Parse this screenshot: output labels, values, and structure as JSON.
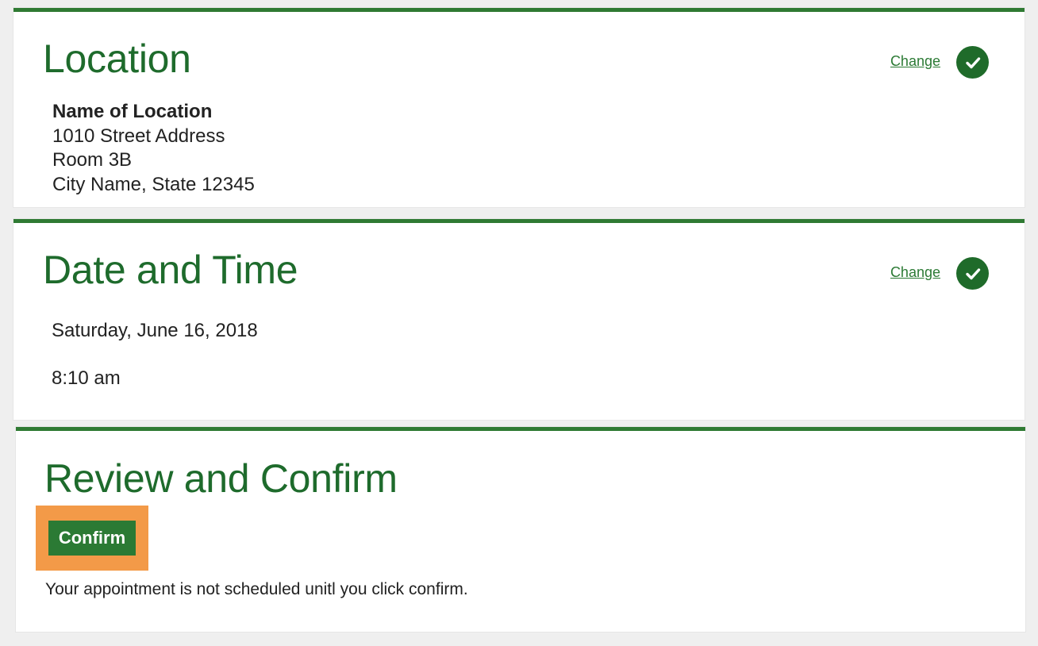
{
  "location": {
    "title": "Location",
    "change_label": "Change",
    "name": "Name of Location",
    "street": "1010 Street Address",
    "room": "Room 3B",
    "city": "City Name, State 12345",
    "status_icon": "check-circle-icon"
  },
  "datetime": {
    "title": "Date and Time",
    "change_label": "Change",
    "date": "Saturday, June 16, 2018",
    "time": "8:10 am",
    "status_icon": "check-circle-icon"
  },
  "review": {
    "title": "Review and Confirm",
    "confirm_label": "Confirm",
    "note": "Your appointment is not scheduled unitl you click confirm."
  },
  "colors": {
    "accent_green": "#2f7a33",
    "title_green": "#1e6b2c",
    "highlight_orange": "#f39a48",
    "background": "#efefef"
  }
}
